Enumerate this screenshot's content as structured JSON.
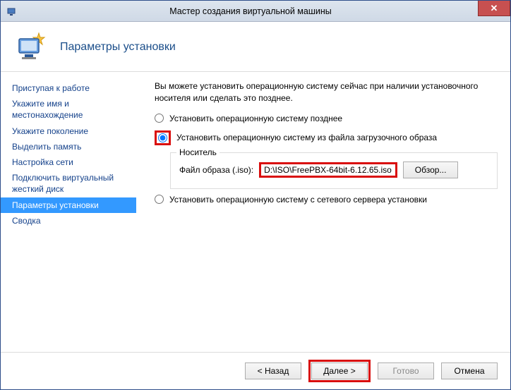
{
  "window": {
    "title": "Мастер создания виртуальной машины"
  },
  "header": {
    "title": "Параметры установки"
  },
  "sidebar": {
    "items": [
      {
        "label": "Приступая к работе"
      },
      {
        "label": "Укажите имя и местонахождение"
      },
      {
        "label": "Укажите поколение"
      },
      {
        "label": "Выделить память"
      },
      {
        "label": "Настройка сети"
      },
      {
        "label": "Подключить виртуальный жесткий диск"
      },
      {
        "label": "Параметры установки"
      },
      {
        "label": "Сводка"
      }
    ],
    "selected_index": 6
  },
  "content": {
    "intro": "Вы можете установить операционную систему сейчас при наличии установочного носителя или сделать это позднее.",
    "option_later": "Установить операционную систему позднее",
    "option_image": "Установить операционную систему из файла загрузочного образа",
    "option_network": "Установить операционную систему с сетевого сервера установки",
    "media_group_label": "Носитель",
    "image_file_label": "Файл образа (.iso):",
    "image_path": "D:\\ISO\\FreePBX-64bit-6.12.65.iso",
    "browse_label": "Обзор..."
  },
  "footer": {
    "back": "< Назад",
    "next": "Далее >",
    "finish": "Готово",
    "cancel": "Отмена"
  }
}
